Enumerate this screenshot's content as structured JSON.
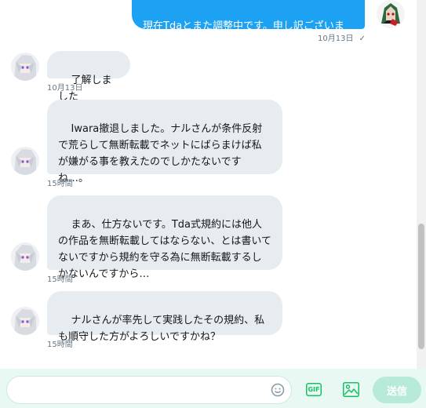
{
  "outgoing": {
    "text": "現在Tdaとまた調整中です。申し訳ございませんがお待ち下さい。",
    "timestamp": "10月13日",
    "status_icon": "check-icon",
    "status_glyph": "✓"
  },
  "messages": [
    {
      "text": "了解しました",
      "timestamp": "10月13日"
    },
    {
      "text": "Iwara撤退しました。ナルさんが条件反射で荒らして無断転載でネットにばらまけば私が嫌がる事を教えたのでしかたないですね…。",
      "timestamp": "15時間"
    },
    {
      "text": "まあ、仕方ないです。Tda式規約には他人の作品を無断転載してはならない、とは書いてないですから規約を守る為に無断転載するしかないんですから…",
      "timestamp": "15時間"
    },
    {
      "text": "ナルさんが率先して実践したその規約、私も順守した方がよろしいですかね？",
      "timestamp": "15時間"
    }
  ],
  "composer": {
    "placeholder": "",
    "emoji_icon": "emoji-icon",
    "gif_label": "GIF",
    "image_icon": "image-icon",
    "send_label": "送信"
  },
  "colors": {
    "outgoing_bubble": "#1da1f2",
    "incoming_bubble": "#e6ecf0",
    "accent": "#17bf63",
    "send_disabled": "#b8ead9",
    "composer_bg": "#e8f8f3"
  }
}
